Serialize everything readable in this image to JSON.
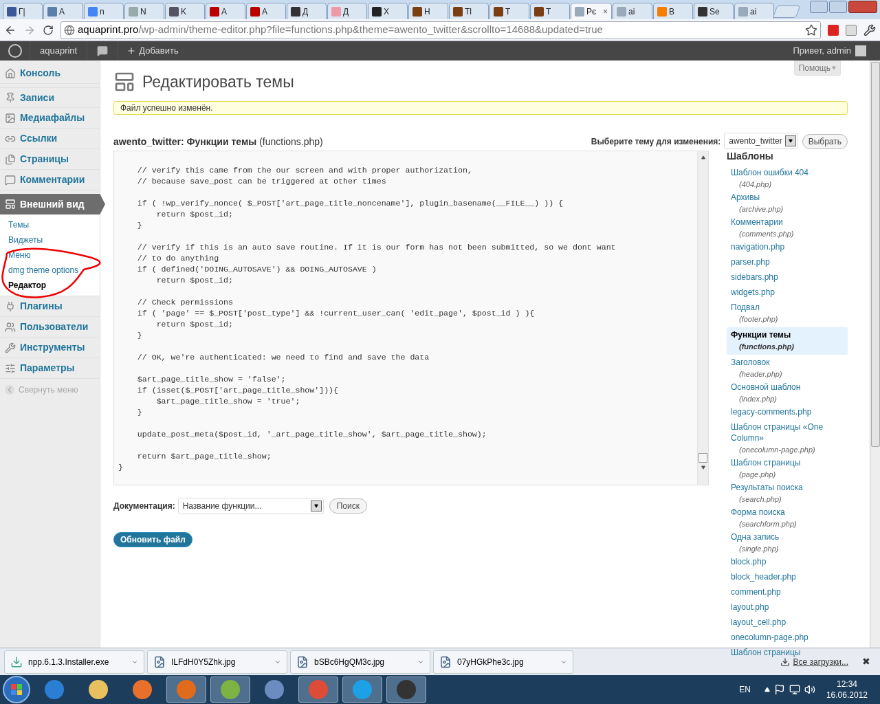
{
  "browser": {
    "tabs": [
      {
        "label": "Г|",
        "selected": false
      },
      {
        "label": "A",
        "selected": false
      },
      {
        "label": "n",
        "selected": false
      },
      {
        "label": "N",
        "selected": false
      },
      {
        "label": "K",
        "selected": false
      },
      {
        "label": "A",
        "selected": false
      },
      {
        "label": "A",
        "selected": false
      },
      {
        "label": "Д",
        "selected": false
      },
      {
        "label": "Д",
        "selected": false
      },
      {
        "label": "X",
        "selected": false
      },
      {
        "label": "H",
        "selected": false
      },
      {
        "label": "Tl",
        "selected": false
      },
      {
        "label": "T",
        "selected": false
      },
      {
        "label": "T",
        "selected": false
      },
      {
        "label": "Pє",
        "selected": true
      },
      {
        "label": "ai",
        "selected": false
      },
      {
        "label": "B",
        "selected": false
      },
      {
        "label": "Se",
        "selected": false
      },
      {
        "label": "ai",
        "selected": false
      }
    ],
    "close_tab": "×",
    "url": {
      "host": "aquaprint.pro",
      "path": "/wp-admin/theme-editor.php?file=functions.php&theme=awento_twitter&scrollto=14688&updated=true"
    }
  },
  "admin_bar": {
    "site": "aquaprint",
    "add": "Добавить",
    "greeting": "Привет, admin"
  },
  "help_button": "Помощь",
  "sidebar": {
    "items": [
      {
        "label": "Консоль",
        "selected": false
      },
      {
        "label": "Записи",
        "selected": false
      },
      {
        "label": "Медиафайлы",
        "selected": false
      },
      {
        "label": "Ссылки",
        "selected": false
      },
      {
        "label": "Страницы",
        "selected": false
      },
      {
        "label": "Комментарии",
        "selected": false
      },
      {
        "label": "Внешний вид",
        "selected": true,
        "children": [
          {
            "label": "Темы",
            "selected": false
          },
          {
            "label": "Виджеты",
            "selected": false
          },
          {
            "label": "Меню",
            "selected": false
          },
          {
            "label": "dmg theme options",
            "selected": false
          },
          {
            "label": "Редактор",
            "selected": true
          }
        ]
      },
      {
        "label": "Плагины",
        "selected": false
      },
      {
        "label": "Пользователи",
        "selected": false
      },
      {
        "label": "Инструменты",
        "selected": false
      },
      {
        "label": "Параметры",
        "selected": false
      }
    ],
    "collapse": "Свернуть меню"
  },
  "page": {
    "title": "Редактировать темы",
    "notice": "Файл успешно изменён.",
    "file_heading": "**awento_twitter: Функции темы** (functions.php)",
    "theme_select": {
      "label": "Выберите тему для изменения:",
      "value": "awento_twitter",
      "button": "Выбрать"
    },
    "code": "    // verify this came from the our screen and with proper authorization,\n    // because save_post can be triggered at other times\n\n    if ( !wp_verify_nonce( $_POST['art_page_title_noncename'], plugin_basename(__FILE__) )) {\n        return $post_id;\n    }\n\n    // verify if this is an auto save routine. If it is our form has not been submitted, so we dont want\n    // to do anything\n    if ( defined('DOING_AUTOSAVE') && DOING_AUTOSAVE )\n        return $post_id;\n\n    // Check permissions\n    if ( 'page' == $_POST['post_type'] && !current_user_can( 'edit_page', $post_id ) ){\n        return $post_id;\n    }\n\n    // OK, we're authenticated: we need to find and save the data\n\n    $art_page_title_show = 'false';\n    if (isset($_POST['art_page_title_show'])){\n        $art_page_title_show = 'true';\n    }\n\n    update_post_meta($post_id, '_art_page_title_show', $art_page_title_show);\n\n    return $art_page_title_show;\n}",
    "templates_heading": "Шаблоны",
    "templates": [
      {
        "name": "Шаблон ошибки 404",
        "file": "(404.php)",
        "selected": false
      },
      {
        "name": "Архивы",
        "file": "(archive.php)",
        "selected": false
      },
      {
        "name": "Комментарии",
        "file": "(comments.php)",
        "selected": false
      },
      {
        "name": "navigation.php",
        "selected": false
      },
      {
        "name": "parser.php",
        "selected": false
      },
      {
        "name": "sidebars.php",
        "selected": false
      },
      {
        "name": "widgets.php",
        "selected": false
      },
      {
        "name": "Подвал",
        "file": "(footer.php)",
        "selected": false
      },
      {
        "name": "Функции темы",
        "file": "(functions.php)",
        "selected": true
      },
      {
        "name": "Заголовок",
        "file": "(header.php)",
        "selected": false
      },
      {
        "name": "Основной шаблон",
        "file": "(index.php)",
        "selected": false
      },
      {
        "name": "legacy-comments.php",
        "selected": false
      },
      {
        "name": "Шаблон страницы «One Column»",
        "file": "(onecolumn-page.php)",
        "selected": false
      },
      {
        "name": "Шаблон страницы",
        "file": "(page.php)",
        "selected": false
      },
      {
        "name": "Результаты поиска",
        "file": "(search.php)",
        "selected": false
      },
      {
        "name": "Форма поиска",
        "file": "(searchform.php)",
        "selected": false
      },
      {
        "name": "Одна запись",
        "file": "(single.php)",
        "selected": false
      },
      {
        "name": "block.php",
        "selected": false
      },
      {
        "name": "block_header.php",
        "selected": false
      },
      {
        "name": "comment.php",
        "selected": false
      },
      {
        "name": "layout.php",
        "selected": false
      },
      {
        "name": "layout_cell.php",
        "selected": false
      },
      {
        "name": "onecolumn-page.php",
        "selected": false
      },
      {
        "name": "Шаблон страницы",
        "selected": false
      }
    ],
    "docs": {
      "label": "Документация:",
      "value": "Название функции...",
      "button": "Поиск"
    },
    "update_button": "Обновить файл"
  },
  "downloads": {
    "items": [
      "npp.6.1.3.Installer.exe",
      "ILFdH0Y5Zhk.jpg",
      "bSBc6HgQM3c.jpg",
      "07yHGkPhe3c.jpg"
    ],
    "all_link": "Все загрузки...",
    "close": "✖"
  },
  "taskbar": {
    "lang": "EN",
    "time": "12:34",
    "date": "16.06.2012"
  }
}
